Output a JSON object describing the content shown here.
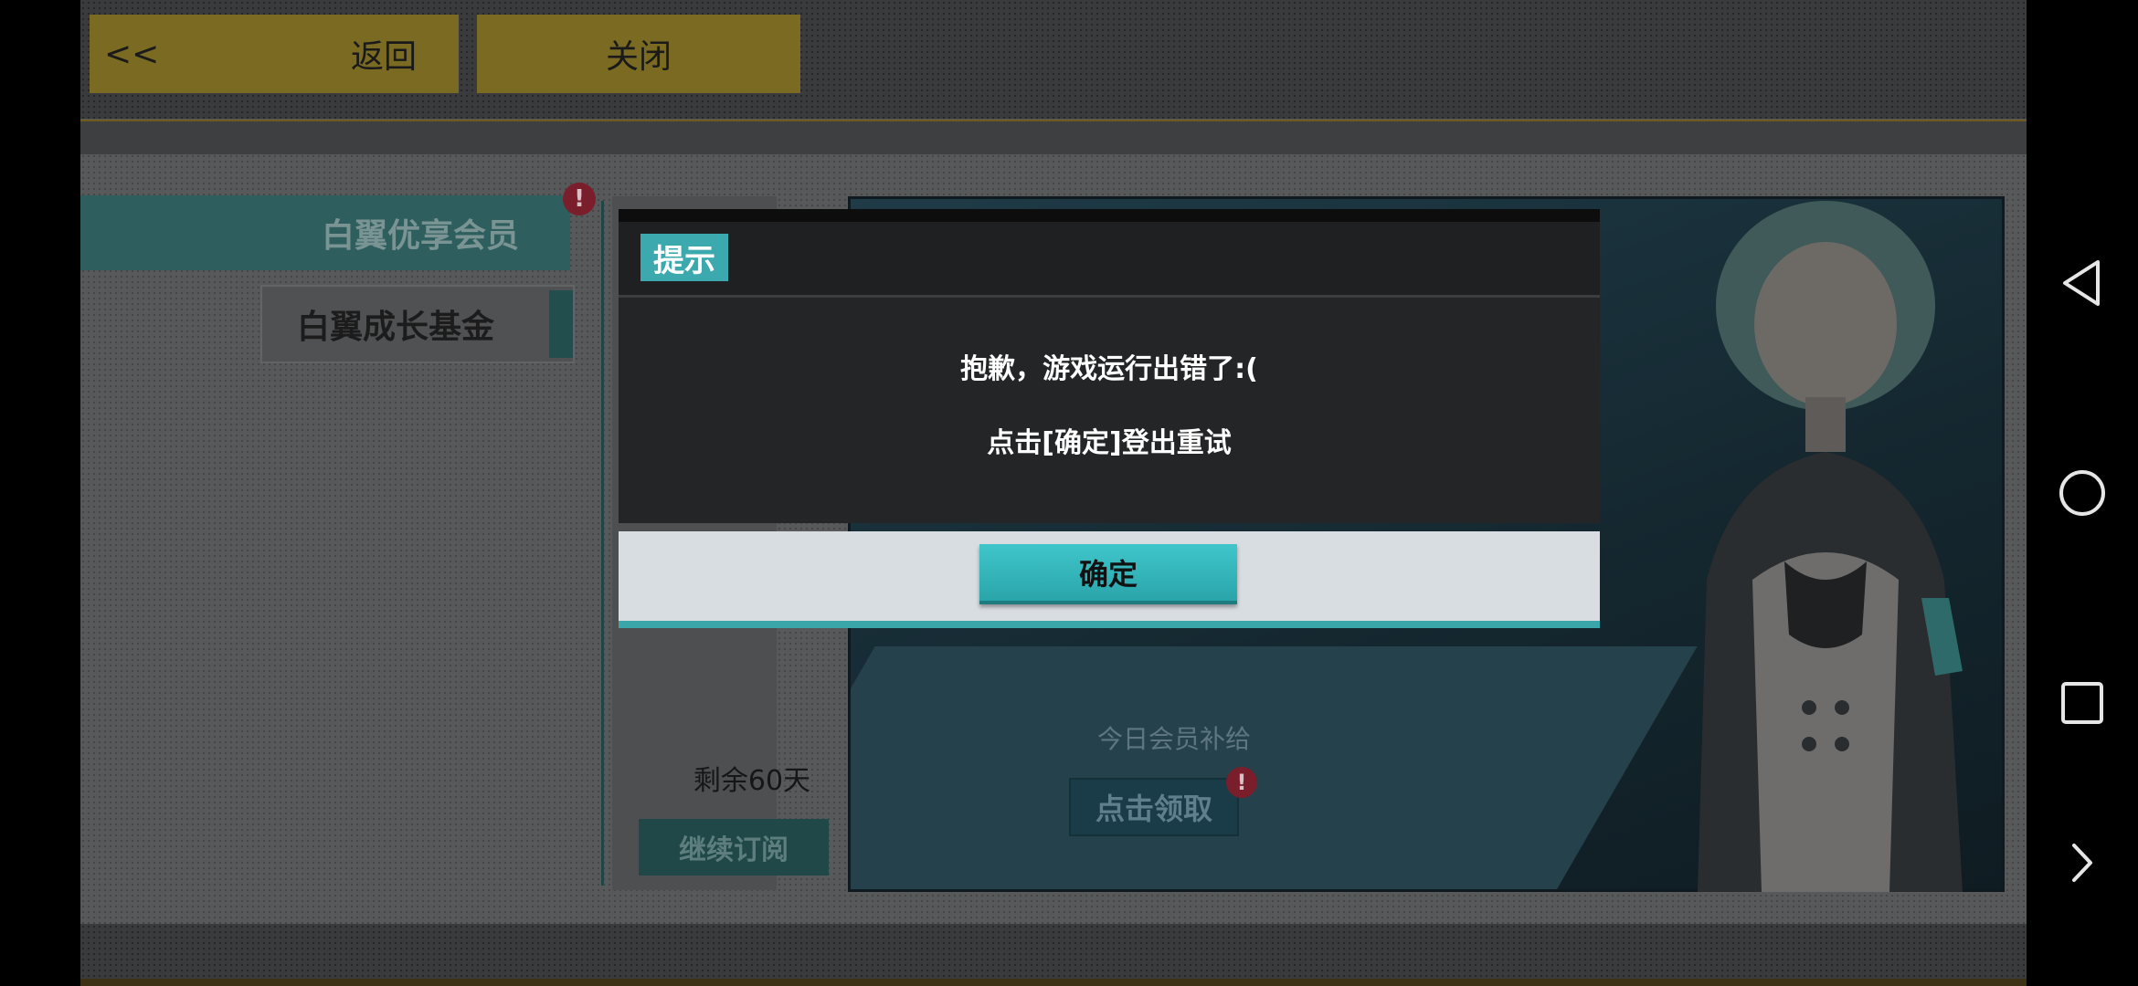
{
  "header": {
    "back_arrow": "<<",
    "back_label": "返回",
    "close_label": "关闭"
  },
  "sidebar": {
    "items": [
      {
        "label": "白翼优享会员"
      },
      {
        "label": "白翼成长基金"
      }
    ],
    "notice_mark": "!"
  },
  "content": {
    "remaining": "剩余60天",
    "renew_label": "继续订阅",
    "daily_supply": "今日会员补给",
    "claim_label": "点击领取",
    "claim_notice": "!"
  },
  "dialog": {
    "title": "提示",
    "message_line1": "抱歉，游戏运行出错了:(",
    "message_line2": "点击[确定]登出重试",
    "confirm_label": "确定"
  },
  "nav": {
    "icons": [
      "back-triangle-icon",
      "home-circle-icon",
      "recents-square-icon",
      "expand-chevron-icon"
    ]
  },
  "colors": {
    "accent_teal": "#3ba9ad",
    "dialog_bg": "#242526",
    "button_gold": "#7a6a22",
    "notice_red": "#7a1e2b"
  }
}
